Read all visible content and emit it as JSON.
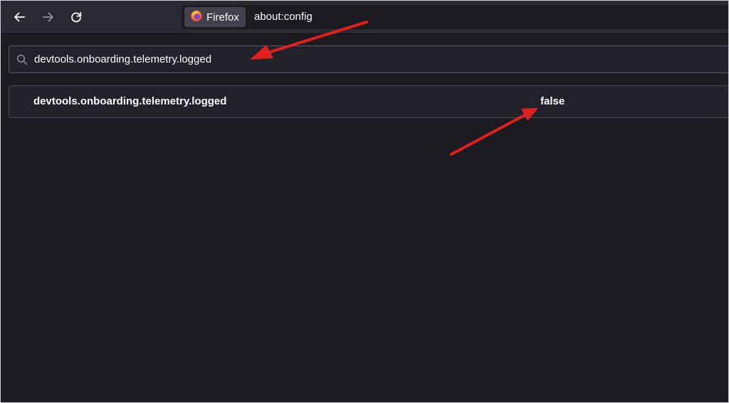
{
  "toolbar": {
    "identity_label": "Firefox",
    "url": "about:config",
    "icons": {
      "back": "arrow-left-icon",
      "forward": "arrow-right-icon",
      "reload": "reload-icon",
      "brand": "firefox-logo-icon"
    }
  },
  "search": {
    "value": "devtools.onboarding.telemetry.logged",
    "icon": "search-icon"
  },
  "preferences": [
    {
      "name": "devtools.onboarding.telemetry.logged",
      "value": "false"
    }
  ],
  "colors": {
    "toolbar_bg": "#2b2a33",
    "content_bg": "#1c1b22",
    "text": "#fbfbfe",
    "annotation_arrow": "#e0201c"
  }
}
